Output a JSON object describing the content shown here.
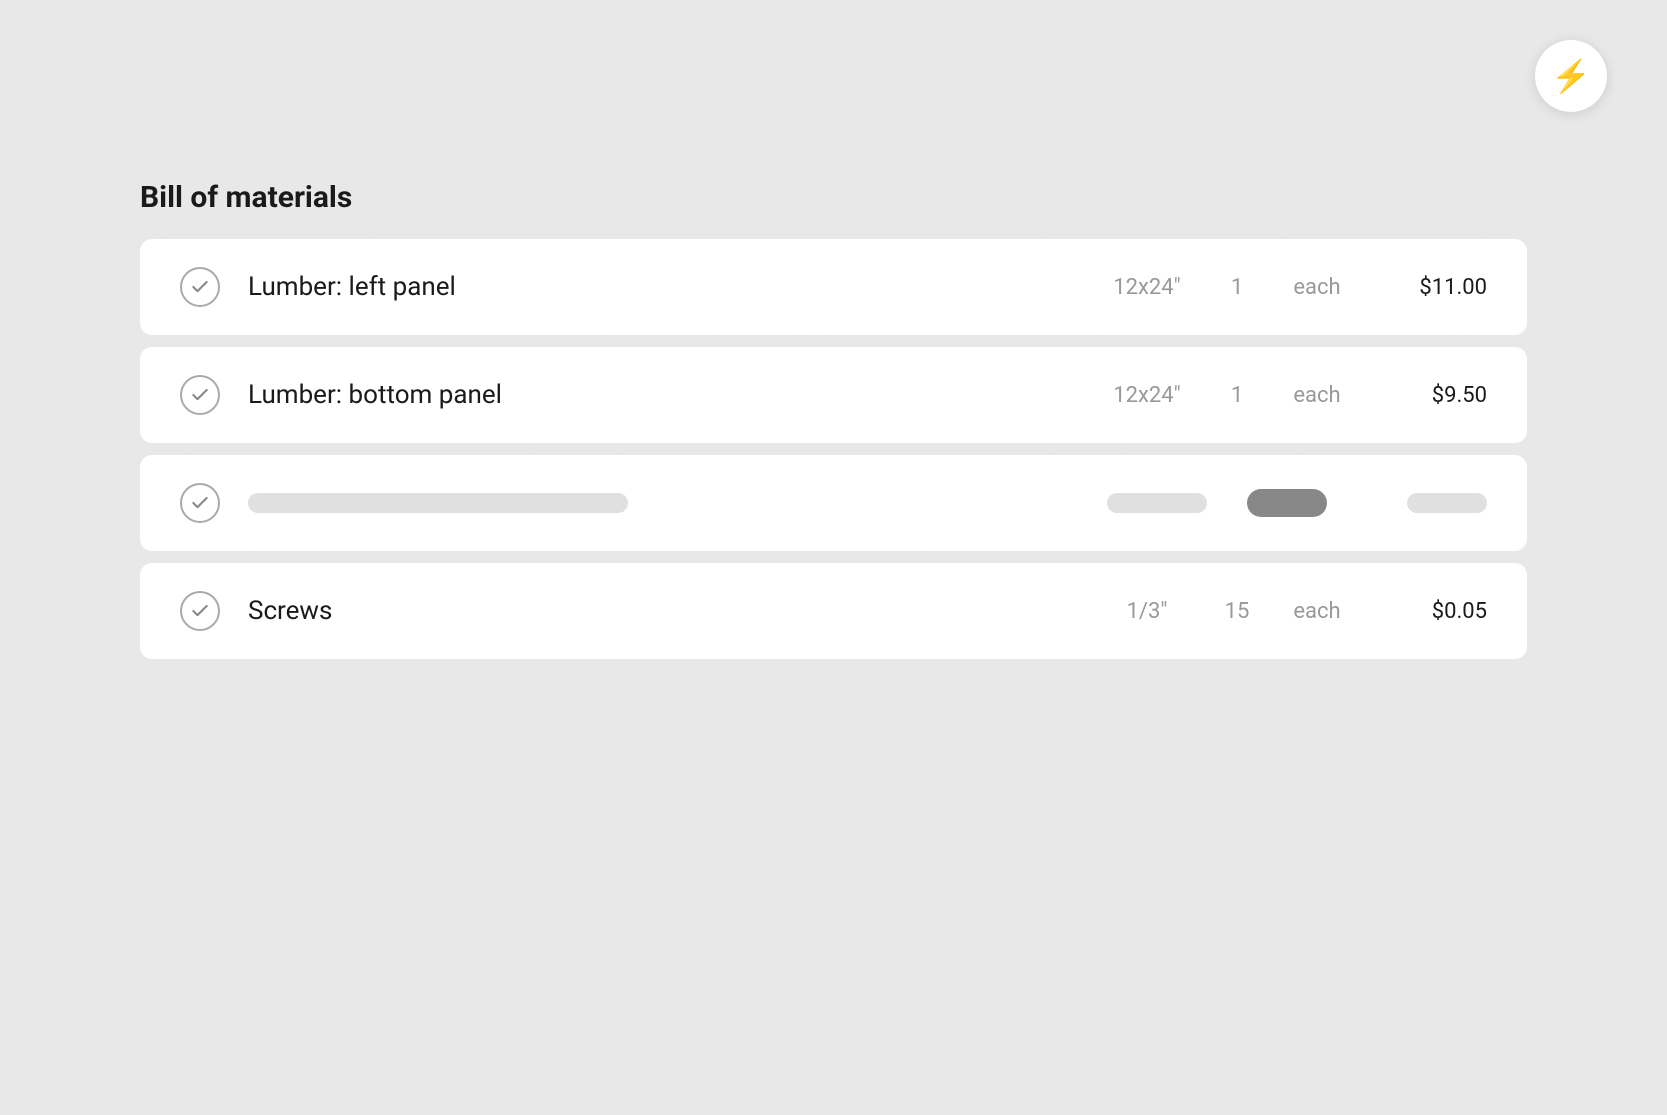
{
  "page": {
    "background_color": "#e8e8e8",
    "title": "Bill of materials"
  },
  "lightning_button": {
    "label": "Lightning",
    "icon": "⚡"
  },
  "materials": [
    {
      "id": "lumber-left",
      "name": "Lumber: left panel",
      "dimension": "12x24\"",
      "quantity": "1",
      "unit": "each",
      "price": "$11.00",
      "checked": true
    },
    {
      "id": "lumber-bottom",
      "name": "Lumber: bottom panel",
      "dimension": "12x24\"",
      "quantity": "1",
      "unit": "each",
      "price": "$9.50",
      "checked": true
    },
    {
      "id": "loading",
      "name": "",
      "dimension": "",
      "quantity": "",
      "unit": "",
      "price": "",
      "checked": true,
      "is_loading": true
    },
    {
      "id": "screws",
      "name": "Screws",
      "dimension": "1/3\"",
      "quantity": "15",
      "unit": "each",
      "price": "$0.05",
      "checked": true
    }
  ]
}
